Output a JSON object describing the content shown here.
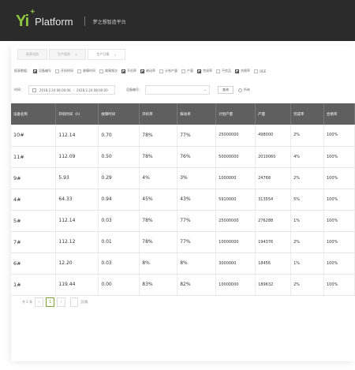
{
  "app": {
    "logo_mark": "Yi",
    "logo_plus": "+",
    "logo_text": "Platform",
    "platform_name": "梦之想智造平台"
  },
  "tabs": [
    {
      "label": "报表导航",
      "active": false
    },
    {
      "label": "生产报表",
      "active": false
    },
    {
      "label": "生产日报",
      "active": true
    }
  ],
  "filters": {
    "label": "报表数据：",
    "options": [
      {
        "label": "设备编号",
        "checked": true
      },
      {
        "label": "开机时间",
        "checked": false
      },
      {
        "label": "故障时间",
        "checked": false
      },
      {
        "label": "故障频次",
        "checked": false
      },
      {
        "label": "开机率",
        "checked": true
      },
      {
        "label": "稼动率",
        "checked": true
      },
      {
        "label": "计划产量",
        "checked": false
      },
      {
        "label": "产量",
        "checked": false
      },
      {
        "label": "完成率",
        "checked": true
      },
      {
        "label": "不良品",
        "checked": false
      },
      {
        "label": "合格率",
        "checked": true
      },
      {
        "label": "OEE",
        "checked": false
      }
    ]
  },
  "query": {
    "time_label": "时间：",
    "start": "2018.2.24 08:00:00",
    "to": "-",
    "end": "2018.2.24 08:00:00",
    "device_label": "设备编号：",
    "device_value": "",
    "button": "查询",
    "radio_label": "所有"
  },
  "table": {
    "columns": [
      "设备名称",
      "开机时间（h）",
      "故障时间",
      "开机率",
      "稼动率",
      "计划产量",
      "产量",
      "完成率",
      "合格率"
    ],
    "rows": [
      [
        "10#",
        "112.14",
        "0.70",
        "78%",
        "77%",
        "25000000",
        "498000",
        "2%",
        "100%"
      ],
      [
        "11#",
        "112.09",
        "0.50",
        "78%",
        "76%",
        "50000000",
        "2010060",
        "4%",
        "100%"
      ],
      [
        "9#",
        "5.93",
        "0.29",
        "4%",
        "3%",
        "1000000",
        "24768",
        "2%",
        "100%"
      ],
      [
        "4#",
        "64.33",
        "0.94",
        "45%",
        "43%",
        "5910000",
        "313554",
        "5%",
        "100%"
      ],
      [
        "5#",
        "112.14",
        "0.03",
        "78%",
        "77%",
        "25000000",
        "276288",
        "1%",
        "100%"
      ],
      [
        "7#",
        "112.12",
        "0.01",
        "78%",
        "77%",
        "10000000",
        "194376",
        "2%",
        "100%"
      ],
      [
        "6#",
        "12.20",
        "0.03",
        "8%",
        "8%",
        "3000000",
        "18456",
        "1%",
        "100%"
      ],
      [
        "1#",
        "119.44",
        "0.00",
        "83%",
        "82%",
        "10000000",
        "189632",
        "2%",
        "100%"
      ]
    ]
  },
  "pager": {
    "total": "共 1 条",
    "prev": "‹",
    "current": "1",
    "next": "›",
    "goto_label": "页/跳"
  },
  "colors": {
    "topbar": "#2b2b2b",
    "brand_green": "#8ec63f",
    "table_header": "#5f5f5f"
  }
}
